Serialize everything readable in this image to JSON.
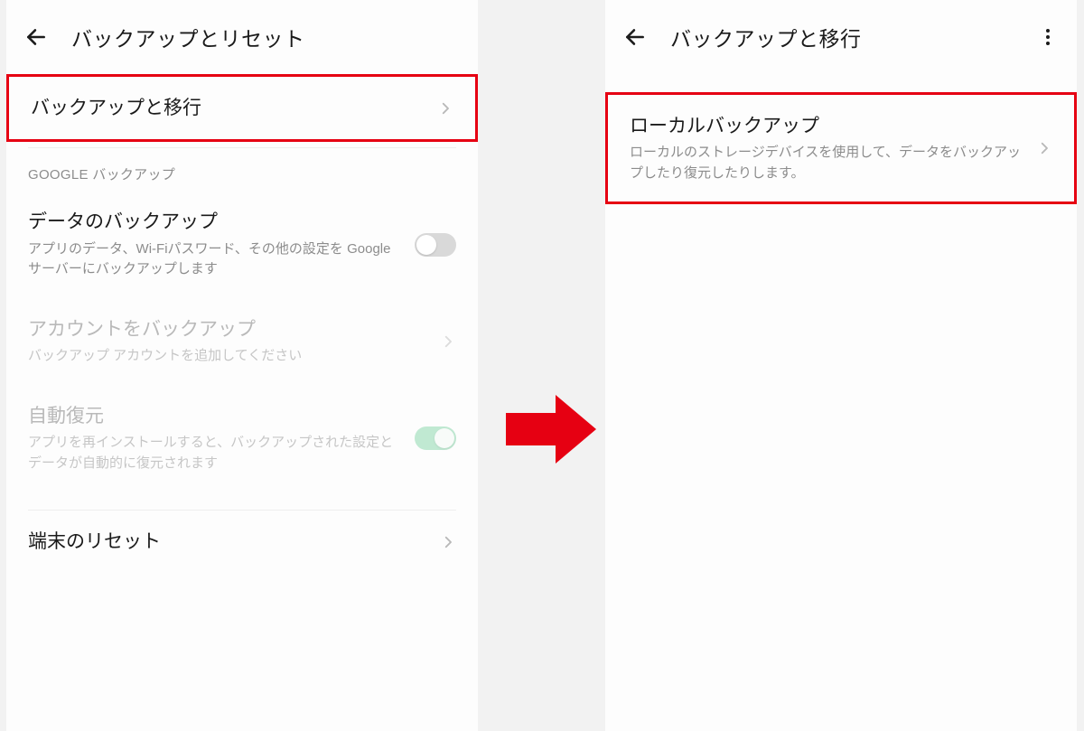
{
  "left": {
    "header_title": "バックアップとリセット",
    "item_migrate": "バックアップと移行",
    "section_google": "GOOGLE バックアップ",
    "item_data_backup_title": "データのバックアップ",
    "item_data_backup_sub": "アプリのデータ、Wi-Fiパスワード、その他の設定を Google サーバーにバックアップします",
    "item_account_title": "アカウントをバックアップ",
    "item_account_sub": "バックアップ アカウントを追加してください",
    "item_autorestore_title": "自動復元",
    "item_autorestore_sub": "アプリを再インストールすると、バックアップされた設定とデータが自動的に復元されます",
    "item_reset": "端末のリセット"
  },
  "right": {
    "header_title": "バックアップと移行",
    "item_local_title": "ローカルバックアップ",
    "item_local_sub": "ローカルのストレージデバイスを使用して、データをバックアップしたり復元したりします。"
  }
}
